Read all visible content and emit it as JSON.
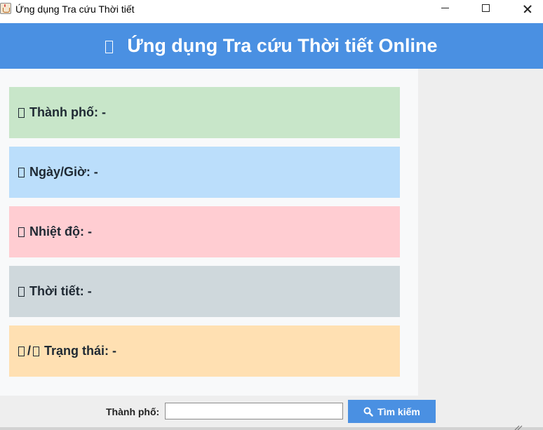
{
  "window": {
    "title": "Ứng dụng Tra cứu Thời tiết",
    "app_icon": "java-coffee-icon",
    "controls": [
      "minimize-icon",
      "maximize-icon",
      "close-icon"
    ]
  },
  "header": {
    "icon": "missing-glyph-box",
    "title": "Ứng dụng Tra cứu Thời tiết Online",
    "background": "#4a90e2"
  },
  "cards": {
    "city": {
      "icon": "missing-glyph-box",
      "text": "Thành phố: -",
      "color": "#c8e6c9"
    },
    "date": {
      "icon": "missing-glyph-box",
      "text": "Ngày/Giờ: -",
      "color": "#bbdefb"
    },
    "temperature": {
      "icon": "missing-glyph-box",
      "text": "Nhiệt độ: -",
      "color": "#ffcdd2"
    },
    "weather": {
      "icon": "missing-glyph-box",
      "text": "Thời tiết: -",
      "color": "#cfd8dc"
    },
    "status": {
      "icon": "missing-glyph-box",
      "text": "Trạng thái: -",
      "color": "#ffe0b2"
    }
  },
  "search": {
    "label": "Thành phố:",
    "value": "",
    "placeholder": "",
    "button_label": "Tìm kiếm",
    "button_icon": "search-icon"
  }
}
